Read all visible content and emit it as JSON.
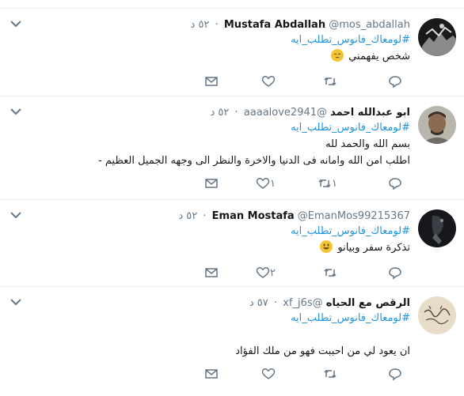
{
  "feed": {
    "tweets": [
      {
        "name": "Mustafa Abdallah",
        "handle": "@mos_abdallah",
        "dot": "·",
        "time": "٥٢ د",
        "hashtag": "#لومعاك_فانوس_تطلب_ايه",
        "lines": [
          "شخص يفهمني"
        ],
        "emoji": "sleepy-face-emoji",
        "reply_count": "",
        "retweet_count": "",
        "like_count": ""
      },
      {
        "name": "ابو عبدالله احمد",
        "handle": "@aaaalove2941",
        "dot": "·",
        "time": "٥٢ د",
        "hashtag": "#لومعاك_فانوس_تطلب_ايه",
        "lines": [
          "بسم الله والحمد لله",
          "اطلب امن الله وامانه فى الدنيا والاخرة والنظر الى وجهه الجميل العظيم -"
        ],
        "emoji": "",
        "reply_count": "",
        "retweet_count": "١",
        "like_count": "١"
      },
      {
        "name": "Eman Mostafa",
        "handle": "@EmanMos99215367",
        "dot": "·",
        "time": "٥٢ د",
        "hashtag": "#لومعاك_فانوس_تطلب_ايه",
        "lines": [
          "تذكرة سفر وبيانو"
        ],
        "emoji": "smiling-face-emoji",
        "reply_count": "",
        "retweet_count": "",
        "like_count": "٢"
      },
      {
        "name": "الرقص مع الحياه",
        "handle": "@xf_j6s",
        "dot": "·",
        "time": "٥٧ د",
        "hashtag": "#لومعاك_فانوس_تطلب_ايه",
        "lines": [
          "ان يعود لي من احببت فهو من ملك الفؤاد"
        ],
        "emoji": "",
        "reply_count": "",
        "retweet_count": "",
        "like_count": ""
      }
    ]
  },
  "icons": {
    "reply": "reply-icon",
    "retweet": "retweet-icon",
    "like": "heart-icon",
    "dm": "envelope-icon",
    "caret": "chevron-down-icon"
  },
  "colors": {
    "hashtag": "#1b95e0",
    "text": "#14171a",
    "muted": "#657786",
    "divider": "#e6ecf0"
  }
}
